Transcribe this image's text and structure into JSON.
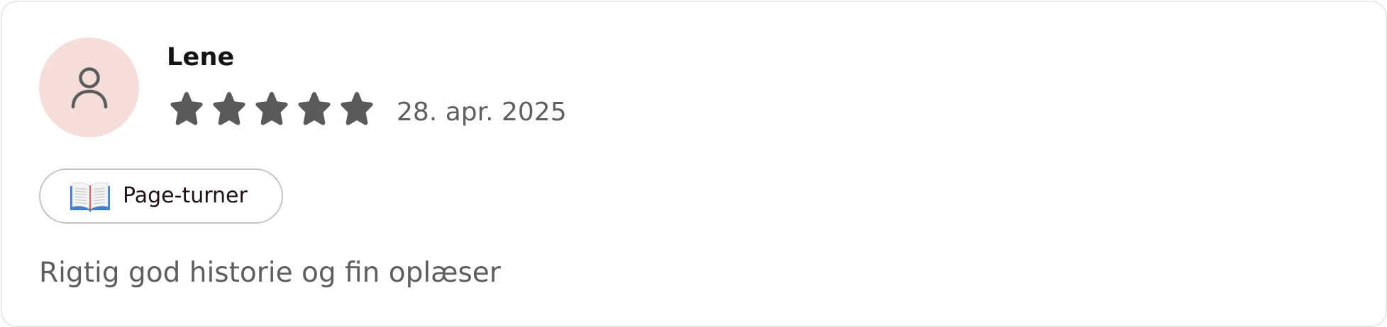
{
  "review": {
    "reviewer_name": "Lene",
    "avatar_icon": "person-icon",
    "rating": 5,
    "rating_max": 5,
    "date": "28. apr. 2025",
    "tag": {
      "icon": "open-book-icon",
      "label": "Page-turner"
    },
    "text": "Rigtig god historie og fin oplæser"
  },
  "colors": {
    "avatar_background": "#f5ddd9",
    "star": "#5a5a5a",
    "muted_text": "#5e5e5e",
    "name_text": "#141414",
    "border": "#e9e9e9"
  }
}
